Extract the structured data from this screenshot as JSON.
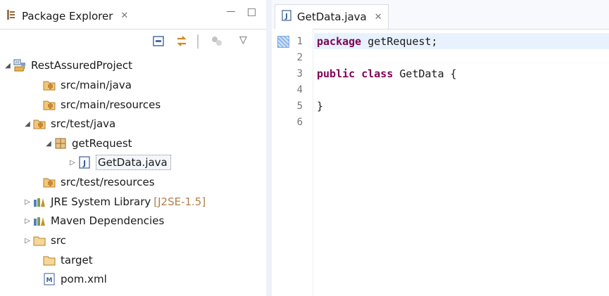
{
  "explorer": {
    "tab_label": "Package Explorer",
    "close_glyph": "✕",
    "minimize_glyph": "—",
    "maximize_glyph": "☐",
    "toolbar": {
      "collapse_icon": "collapse-all-icon",
      "link_icon": "link-with-editor-icon",
      "focus_icon": "focus-on-active-icon",
      "menu_icon": "view-menu-icon",
      "menu_glyph": "▽"
    },
    "tree": [
      {
        "label": "RestAssuredProject",
        "icon": "maven-project-icon",
        "toggle": "◢",
        "decoration": ""
      },
      {
        "label": "src/main/java",
        "icon": "source-folder-icon",
        "toggle": "",
        "decoration": ""
      },
      {
        "label": "src/main/resources",
        "icon": "source-folder-icon",
        "toggle": "",
        "decoration": ""
      },
      {
        "label": "src/test/java",
        "icon": "source-folder-icon",
        "toggle": "◢",
        "decoration": ""
      },
      {
        "label": "getRequest",
        "icon": "package-icon",
        "toggle": "◢",
        "decoration": ""
      },
      {
        "label": "GetData.java",
        "icon": "java-file-icon",
        "toggle": "▷",
        "decoration": ""
      },
      {
        "label": "src/test/resources",
        "icon": "source-folder-icon",
        "toggle": "",
        "decoration": ""
      },
      {
        "label": "JRE System Library",
        "icon": "library-icon",
        "toggle": "▷",
        "decoration": "[J2SE-1.5]"
      },
      {
        "label": "Maven Dependencies",
        "icon": "library-icon",
        "toggle": "▷",
        "decoration": ""
      },
      {
        "label": "src",
        "icon": "folder-icon",
        "toggle": "▷",
        "decoration": ""
      },
      {
        "label": "target",
        "icon": "folder-icon",
        "toggle": "",
        "decoration": ""
      },
      {
        "label": "pom.xml",
        "icon": "maven-xml-icon",
        "toggle": "",
        "decoration": ""
      }
    ]
  },
  "editor": {
    "tab_label": "GetData.java",
    "close_glyph": "✕",
    "line_numbers": [
      "1",
      "2",
      "3",
      "4",
      "5",
      "6"
    ],
    "code": {
      "l1_kw": "package",
      "l1_rest": " getRequest;",
      "l3_kw1": "public",
      "l3_kw2": "class",
      "l3_rest": " GetData {",
      "l5": "}"
    }
  },
  "colors": {
    "keyword": "#7f0055",
    "decoration": "#b0804a",
    "current_line": "#e8f2fe"
  }
}
